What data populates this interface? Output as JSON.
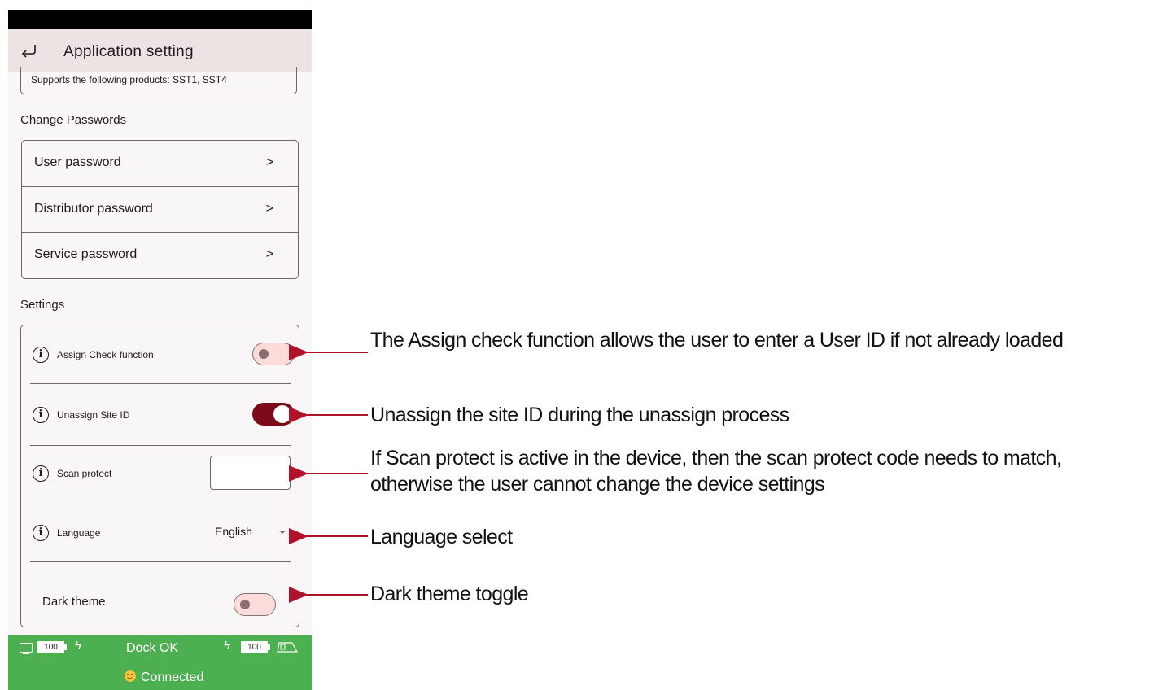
{
  "app": {
    "title": "Application setting",
    "supports_text": "Supports the following products: SST1, SST4"
  },
  "passwords": {
    "section_title": "Change Passwords",
    "items": [
      {
        "label": "User password",
        "chevron": ">"
      },
      {
        "label": "Distributor password",
        "chevron": ">"
      },
      {
        "label": "Service password",
        "chevron": ">"
      }
    ]
  },
  "settings": {
    "section_title": "Settings",
    "assign_check": {
      "label": "Assign Check function",
      "enabled": false
    },
    "unassign_site": {
      "label": "Unassign Site ID",
      "enabled": true
    },
    "scan_protect": {
      "label": "Scan protect",
      "value": ""
    },
    "language": {
      "label": "Language",
      "value": "English"
    },
    "dark_theme": {
      "label": "Dark theme",
      "enabled": false
    },
    "info_glyph": "i"
  },
  "status": {
    "monitor_battery": "100",
    "dock_text": "Dock OK",
    "tablet_battery": "100",
    "connection_text": "Connected",
    "bar_color": "#4caf50"
  },
  "annotations": [
    {
      "id": "assign",
      "text": "The Assign check function allows the user to enter a User ID if not already loaded"
    },
    {
      "id": "unassign",
      "text": "Unassign the site ID during the unassign process"
    },
    {
      "id": "scan",
      "text": "If Scan protect is active in the device, then the scan protect code needs to match, otherwise the user cannot change the device settings"
    },
    {
      "id": "language",
      "text": "Language select"
    },
    {
      "id": "dark",
      "text": "Dark theme toggle"
    }
  ],
  "colors": {
    "accent": "#7c0a1b",
    "arrow": "#b0122b",
    "toggle_off_bg": "#fbdcda",
    "appbar": "#eee3e3"
  }
}
